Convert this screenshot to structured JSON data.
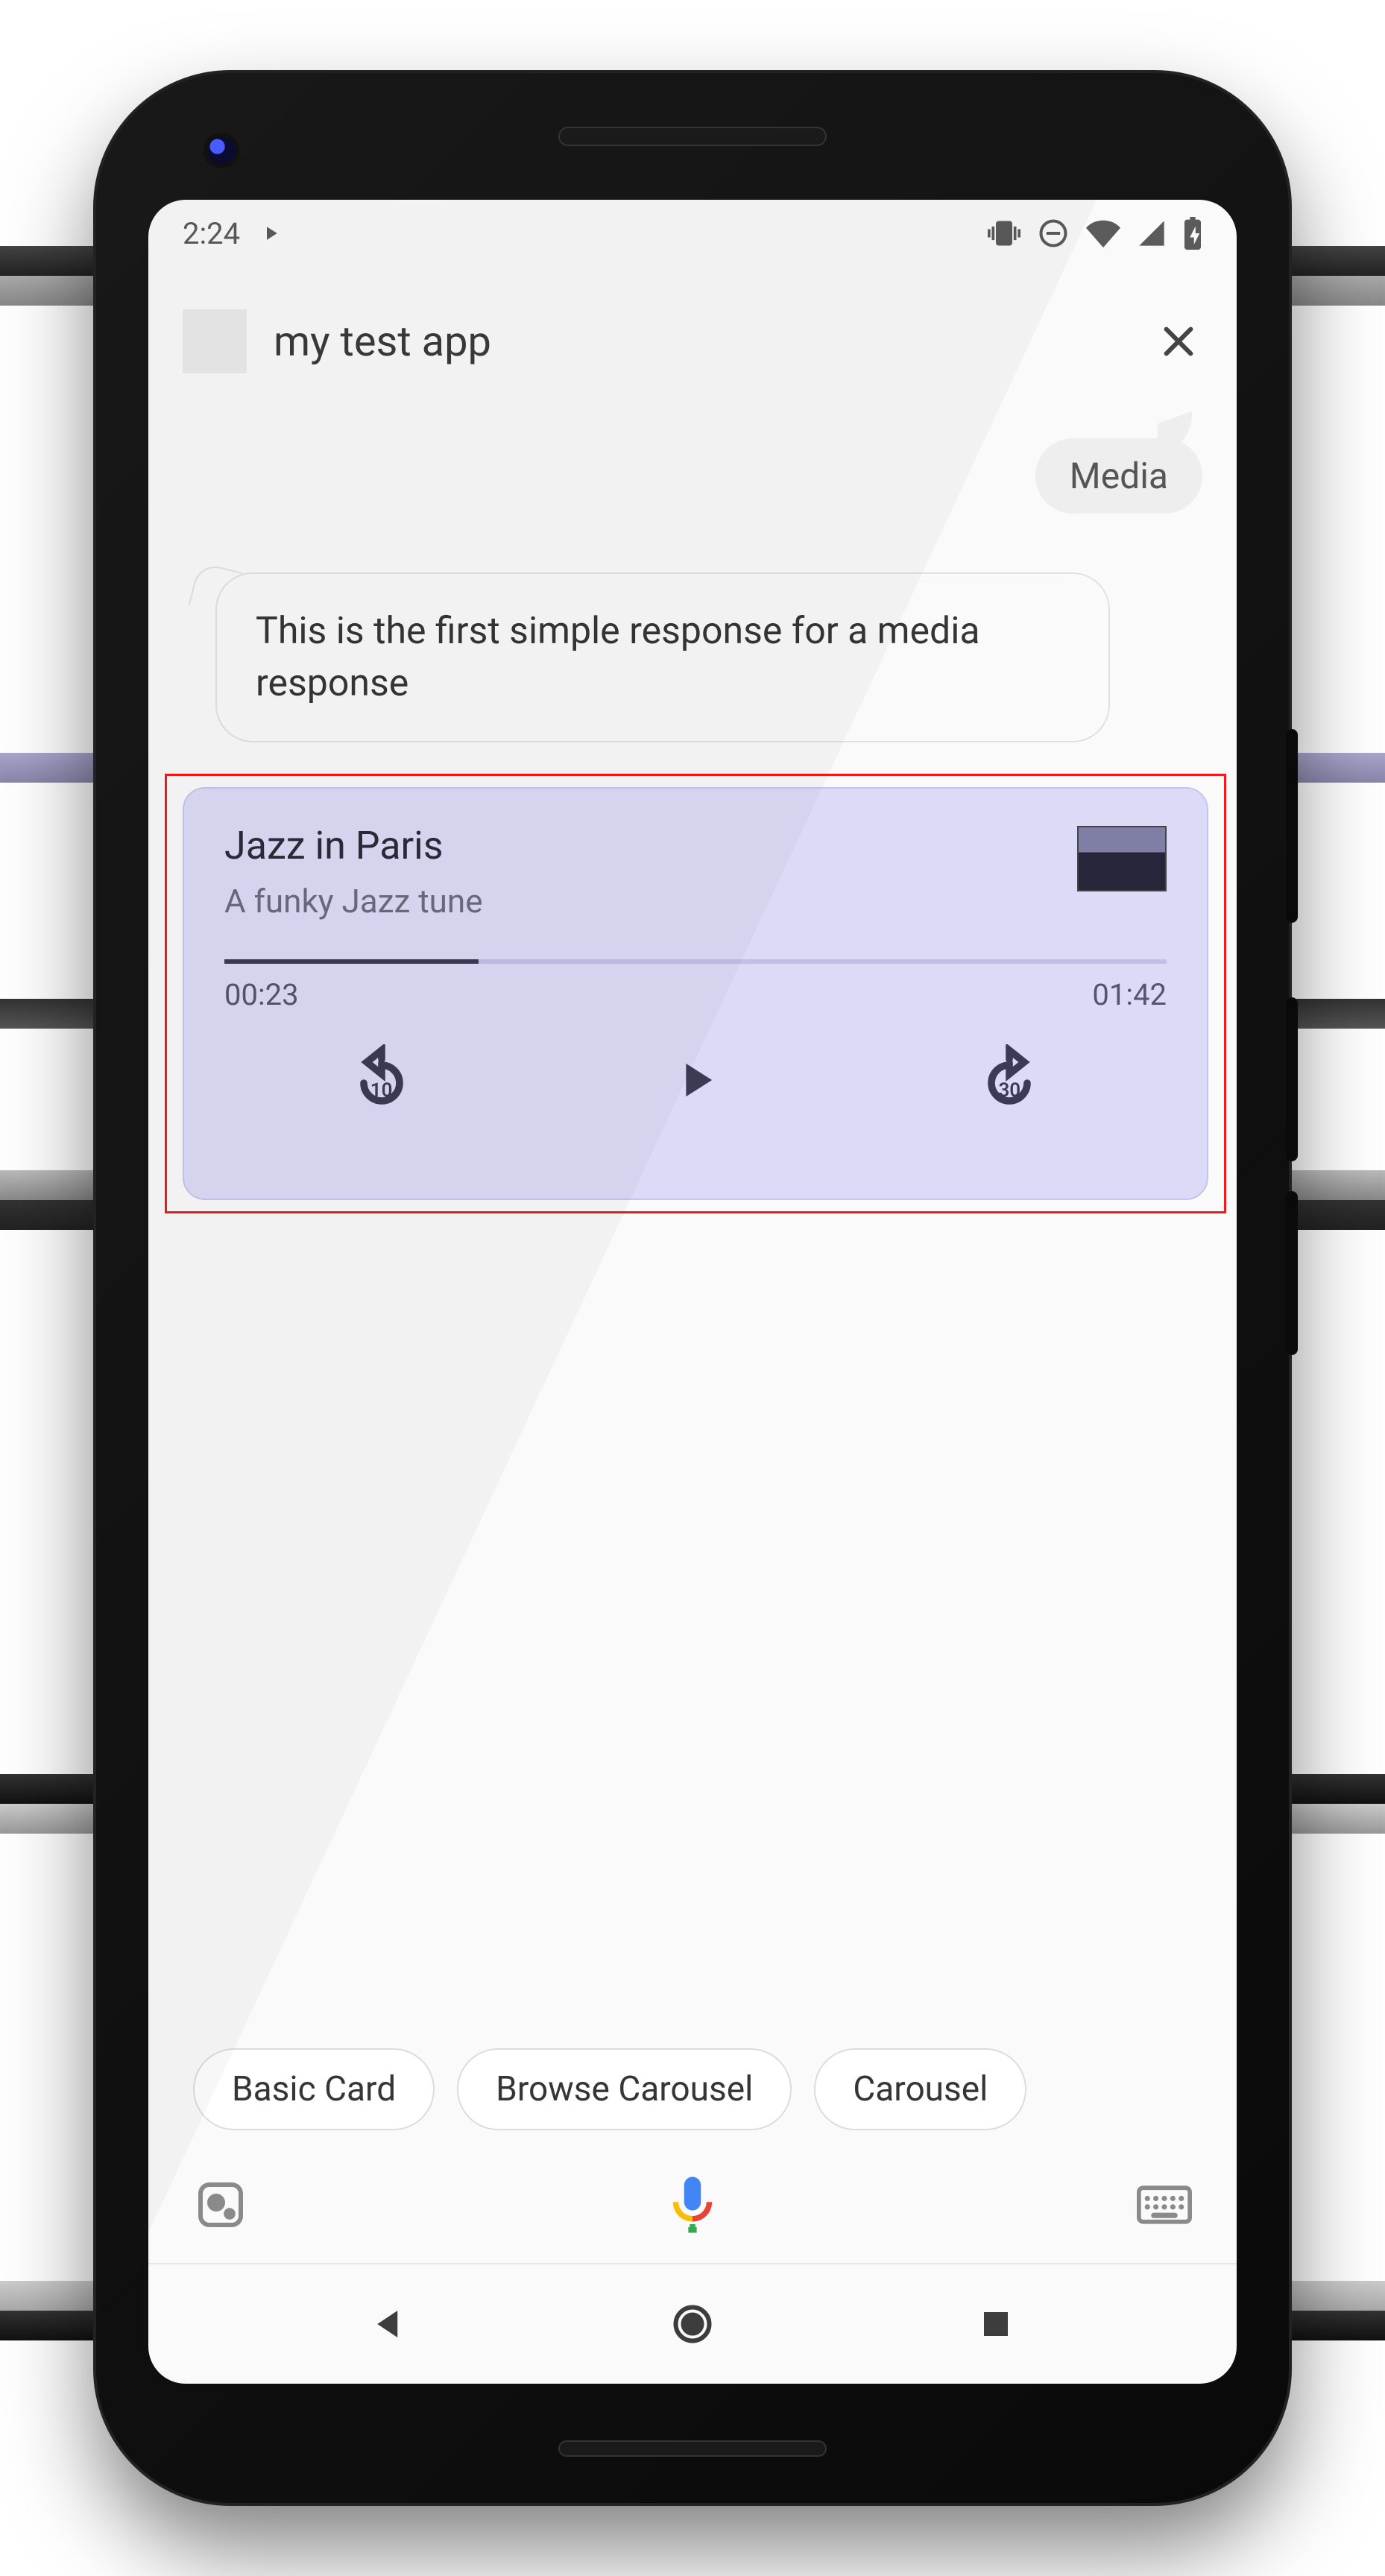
{
  "statusbar": {
    "time": "2:24"
  },
  "header": {
    "title": "my test app"
  },
  "conversation": {
    "user_chip": "Media",
    "response_text": "This is the first simple response for a media response"
  },
  "media": {
    "title": "Jazz in Paris",
    "subtitle": "A funky Jazz tune",
    "elapsed": "00:23",
    "duration": "01:42",
    "rewind_seconds": "10",
    "forward_seconds": "30",
    "progress_percent": 27
  },
  "chips": {
    "items": [
      {
        "label": "Basic Card"
      },
      {
        "label": "Browse Carousel"
      },
      {
        "label": "Carousel"
      }
    ]
  }
}
